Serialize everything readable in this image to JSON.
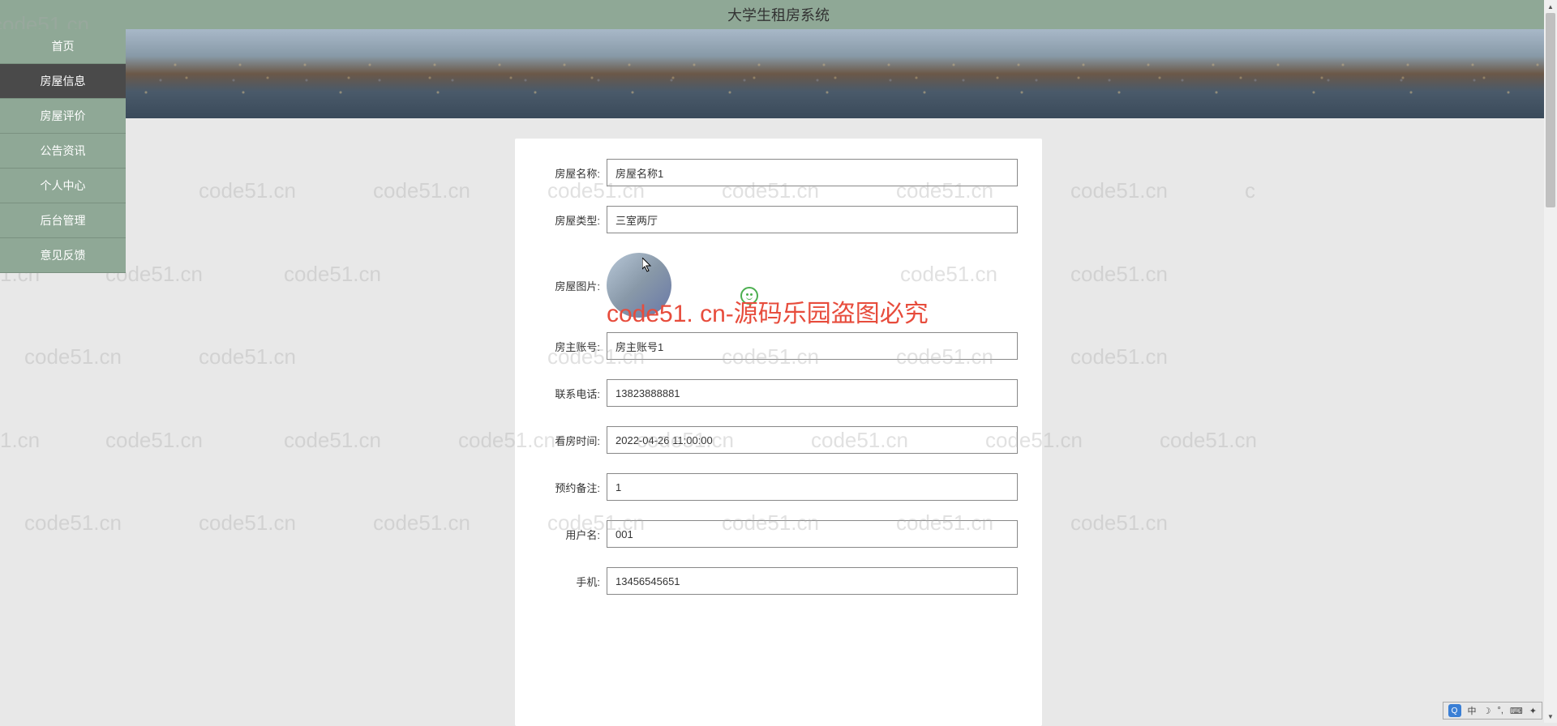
{
  "header": {
    "title": "大学生租房系统"
  },
  "sidebar": {
    "items": [
      {
        "label": "首页"
      },
      {
        "label": "房屋信息"
      },
      {
        "label": "房屋评价"
      },
      {
        "label": "公告资讯"
      },
      {
        "label": "个人中心"
      },
      {
        "label": "后台管理"
      },
      {
        "label": "意见反馈"
      }
    ],
    "activeIndex": 1
  },
  "form": {
    "fields": [
      {
        "label": "房屋名称:",
        "value": "房屋名称1"
      },
      {
        "label": "房屋类型:",
        "value": "三室两厅"
      },
      {
        "label": "房屋图片:",
        "type": "image"
      },
      {
        "label": "房主账号:",
        "value": "房主账号1"
      },
      {
        "label": "联系电话:",
        "value": "13823888881"
      },
      {
        "label": "看房时间:",
        "value": "2022-04-26 11:00:00"
      },
      {
        "label": "预约备注:",
        "value": "1"
      },
      {
        "label": "用户名:",
        "value": "001"
      },
      {
        "label": "手机:",
        "value": "13456545651"
      }
    ]
  },
  "watermark": {
    "red": "code51. cn-源码乐园盗图必究",
    "bg": "code51.cn"
  },
  "ime": {
    "label": "中"
  }
}
